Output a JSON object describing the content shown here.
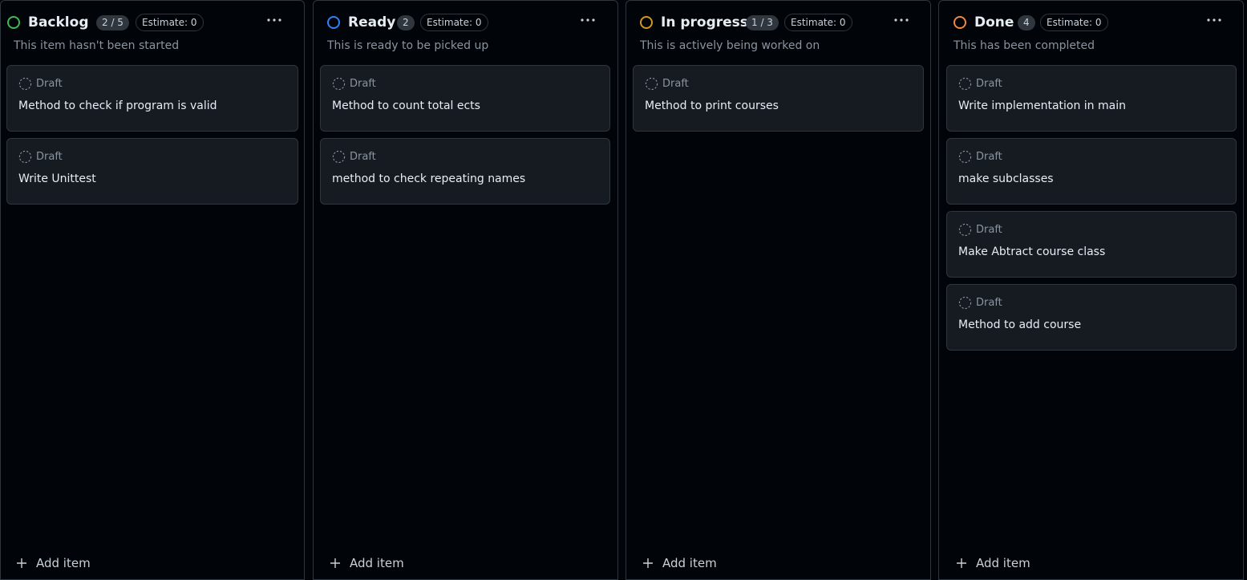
{
  "columns": [
    {
      "title": "Backlog",
      "count": "2 / 5",
      "estimate": "Estimate: 0",
      "description": "This item hasn't been started",
      "status_color": "#3fb950",
      "add_label": "Add item",
      "items": [
        {
          "status": "Draft",
          "title": "Method to check if program is valid"
        },
        {
          "status": "Draft",
          "title": "Write Unittest"
        }
      ]
    },
    {
      "title": "Ready",
      "count": "2",
      "estimate": "Estimate: 0",
      "description": "This is ready to be picked up",
      "status_color": "#2f81f7",
      "add_label": "Add item",
      "items": [
        {
          "status": "Draft",
          "title": "Method to count total ects"
        },
        {
          "status": "Draft",
          "title": "method to check repeating names"
        }
      ]
    },
    {
      "title": "In progress",
      "count": "1 / 3",
      "estimate": "Estimate: 0",
      "description": "This is actively being worked on",
      "status_color": "#d29922",
      "add_label": "Add item",
      "items": [
        {
          "status": "Draft",
          "title": "Method to print courses"
        }
      ]
    },
    {
      "title": "Done",
      "count": "4",
      "estimate": "Estimate: 0",
      "description": "This has been completed",
      "status_color": "#f0883e",
      "add_label": "Add item",
      "items": [
        {
          "status": "Draft",
          "title": "Write implementation in main"
        },
        {
          "status": "Draft",
          "title": "make subclasses"
        },
        {
          "status": "Draft",
          "title": "Make Abtract course class"
        },
        {
          "status": "Draft",
          "title": "Method to add course"
        }
      ]
    }
  ],
  "icons": {
    "status": "status-circle-icon",
    "menu": "kebab-menu-icon",
    "draft": "draft-dashed-circle-icon",
    "add": "plus-icon"
  }
}
